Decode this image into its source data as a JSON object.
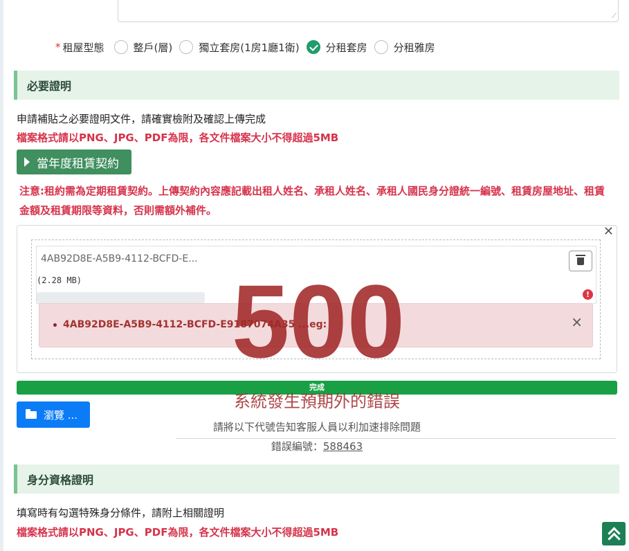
{
  "housing_type": {
    "label": "租屋型態",
    "required_mark": "*",
    "options": [
      "整戶(層)",
      "獨立套房(1房1廳1衛)",
      "分租套房",
      "分租雅房"
    ],
    "selected": "分租套房"
  },
  "required_docs": {
    "title": "必要證明",
    "intro": "申請補貼之必要證明文件，請確實檢附及確認上傳完成",
    "format_note": "檔案格式請以PNG、JPG、PDF為限，各文件檔案大小不得超過5MB",
    "contract_button": "當年度租賃契約",
    "notice": "注意:租約需為定期租賃契約。上傳契約內容應記載出租人姓名、承租人姓名、承租人國民身分證統一編號、租賃房屋地址、租賃金額及租賃期限等資料，否則需額外補件。"
  },
  "upload": {
    "file_name": "4AB92D8E-A5B9-4112-BCFD-E...",
    "file_size": "(2.28 MB)",
    "error_text": "4AB92D8E-A5B9-4112-BCFD-E9187074A35 ...eg:",
    "progress_label": "完成",
    "browse_label": "瀏覽 ..."
  },
  "error_overlay": {
    "code": "500",
    "title": "系統發生預期外的錯誤",
    "subtitle": "請將以下代號告知客服人員以利加速排除問題",
    "error_id_label": "錯誤編號：",
    "error_id": "588463"
  },
  "identity_docs": {
    "title": "身分資格證明",
    "intro": "填寫時有勾選特殊身分條件，請附上相關證明",
    "format_note": "檔案格式請以PNG、JPG、PDF為限，各文件檔案大小不得超過5MB"
  },
  "colors": {
    "accent_green": "#3f8f5f",
    "progress_green": "#19a045",
    "browse_blue": "#0b7cf6",
    "error_red": "#d6334b"
  }
}
